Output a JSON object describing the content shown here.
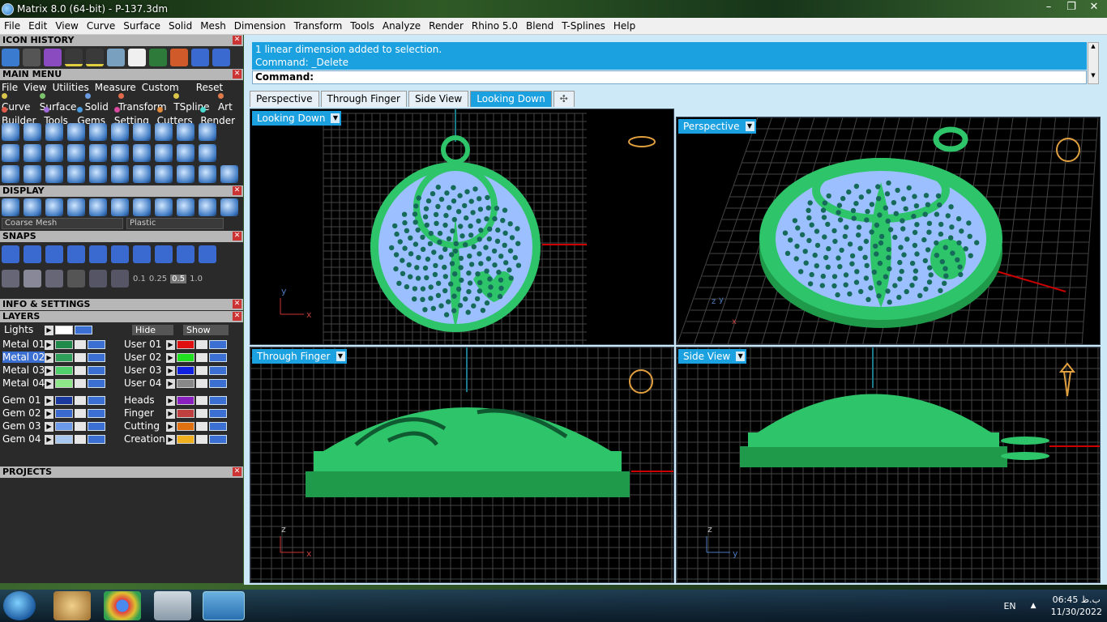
{
  "window": {
    "title": "Matrix 8.0 (64-bit) - P-137.3dm",
    "minimize": "–",
    "maximize": "❐",
    "close": "✕"
  },
  "menubar": [
    "File",
    "Edit",
    "View",
    "Curve",
    "Surface",
    "Solid",
    "Mesh",
    "Dimension",
    "Transform",
    "Tools",
    "Analyze",
    "Render",
    "Rhino 5.0",
    "Blend",
    "T-Splines",
    "Help"
  ],
  "panels": {
    "icon_history": "ICON HISTORY",
    "main_menu": "MAIN MENU",
    "display": "DISPLAY",
    "snaps": "SNAPS",
    "info_settings": "INFO & SETTINGS",
    "layers": "LAYERS",
    "projects": "PROJECTS",
    "close": "✕"
  },
  "main_menu": {
    "file": "File",
    "view": "View",
    "utilities": "Utilities",
    "measure": "Measure",
    "custom": "Custom",
    "reset": "Reset",
    "row1": [
      {
        "label": "Curve",
        "color": "#d9c64a"
      },
      {
        "label": "Surface",
        "color": "#7cc36b"
      },
      {
        "label": "Solid",
        "color": "#6a9be0"
      },
      {
        "label": "Transform",
        "color": "#e06a4a"
      },
      {
        "label": "TSpline",
        "color": "#d9c64a"
      },
      {
        "label": "Art",
        "color": "#e07a4a"
      }
    ],
    "row2": [
      {
        "label": "Builder",
        "color": "#e05a4a"
      },
      {
        "label": "Tools",
        "color": "#a06ad9"
      },
      {
        "label": "Gems",
        "color": "#4a9be0"
      },
      {
        "label": "Setting",
        "color": "#d94aa0"
      },
      {
        "label": "Cutters",
        "color": "#e08a3a"
      },
      {
        "label": "Render",
        "color": "#4ad9d0"
      }
    ]
  },
  "display": {
    "mesh_option": "Coarse Mesh",
    "material_option": "Plastic"
  },
  "snaps": {
    "values": [
      "0.1",
      "0.25",
      "0.5",
      "1.0"
    ]
  },
  "layers": {
    "lights": "Lights",
    "hide": "Hide",
    "show": "Show",
    "left": [
      {
        "name": "Metal 01",
        "color": "#1f8a4a"
      },
      {
        "name": "Metal 02",
        "color": "#2ea05a"
      },
      {
        "name": "Metal 03",
        "color": "#4fd06a"
      },
      {
        "name": "Metal 04",
        "color": "#8ee88a"
      },
      {
        "name": "Gem 01",
        "color": "#1a3aa0"
      },
      {
        "name": "Gem 02",
        "color": "#3a6ad0"
      },
      {
        "name": "Gem 03",
        "color": "#6a9ae8"
      },
      {
        "name": "Gem 04",
        "color": "#a8c8f0"
      }
    ],
    "right": [
      {
        "name": "User 01",
        "color": "#e01010"
      },
      {
        "name": "User 02",
        "color": "#20e020"
      },
      {
        "name": "User 03",
        "color": "#1020e0"
      },
      {
        "name": "User 04",
        "color": "#888888"
      },
      {
        "name": "Heads",
        "color": "#8a20c0"
      },
      {
        "name": "Finger",
        "color": "#c04040"
      },
      {
        "name": "Cutting",
        "color": "#e07010"
      },
      {
        "name": "Creation",
        "color": "#f0b020"
      }
    ]
  },
  "command": {
    "log_line1": "1 linear dimension added to selection.",
    "log_line2": "Command: _Delete",
    "prompt": "Command:",
    "scroll_up": "▲",
    "scroll_down": "▼"
  },
  "viewport_tabs": [
    "Perspective",
    "Through Finger",
    "Side View",
    "Looking Down",
    "✣"
  ],
  "viewports": {
    "top_left": "Looking Down",
    "top_right": "Perspective",
    "bottom_left": "Through Finger",
    "bottom_right": "Side View",
    "arrow": "▼"
  },
  "axes": {
    "x": "x",
    "y": "y",
    "z": "z"
  },
  "colors": {
    "accent": "#1ba0e0",
    "model": "#2ec46a",
    "gems": "#8fb7ff",
    "grid": "#555555"
  },
  "taskbar": {
    "lang": "EN",
    "tray_arrow": "▲",
    "time": "06:45 ب.ظ",
    "date": "11/30/2022"
  }
}
